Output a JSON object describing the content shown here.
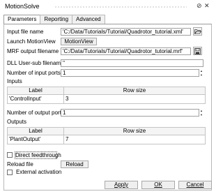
{
  "header": {
    "title": "MotionSolve"
  },
  "tabs": [
    {
      "label": "Parameters"
    },
    {
      "label": "Reporting"
    },
    {
      "label": "Advanced"
    }
  ],
  "form": {
    "input_file_label": "Input file name",
    "input_file_value": "'C:/Data/Tutorials/Tutorial/Quadrotor_tutorial.xml'",
    "launch_label": "Launch MotionView",
    "launch_button": "MotionView",
    "mrf_label": "MRF output filename",
    "mrf_value": "'C:/Data/Tutorials/Tutorial/Quadrotor_tutorial.mrf'",
    "dll_label": "DLL User-sub filename",
    "dll_value": "''",
    "num_inputs_label": "Number of input ports",
    "num_inputs_value": "1",
    "inputs_section": "Inputs",
    "inputs_table": {
      "col_label": "Label",
      "col_rowsize": "Row size",
      "rows": [
        {
          "label": "'ControlInput'",
          "rowsize": "3"
        }
      ]
    },
    "num_outputs_label": "Number of output ports",
    "num_outputs_value": "1",
    "outputs_section": "Outputs",
    "outputs_table": {
      "col_label": "Label",
      "col_rowsize": "Row size",
      "rows": [
        {
          "label": "'PlantOutput'",
          "rowsize": "7"
        }
      ]
    },
    "direct_feedthrough_label": "Direct feedthrough",
    "reload_label": "Reload file",
    "reload_button": "Reload",
    "external_activation_label": "External activation"
  },
  "footer": {
    "apply": "Apply",
    "ok": "OK",
    "cancel": "Cancel"
  }
}
